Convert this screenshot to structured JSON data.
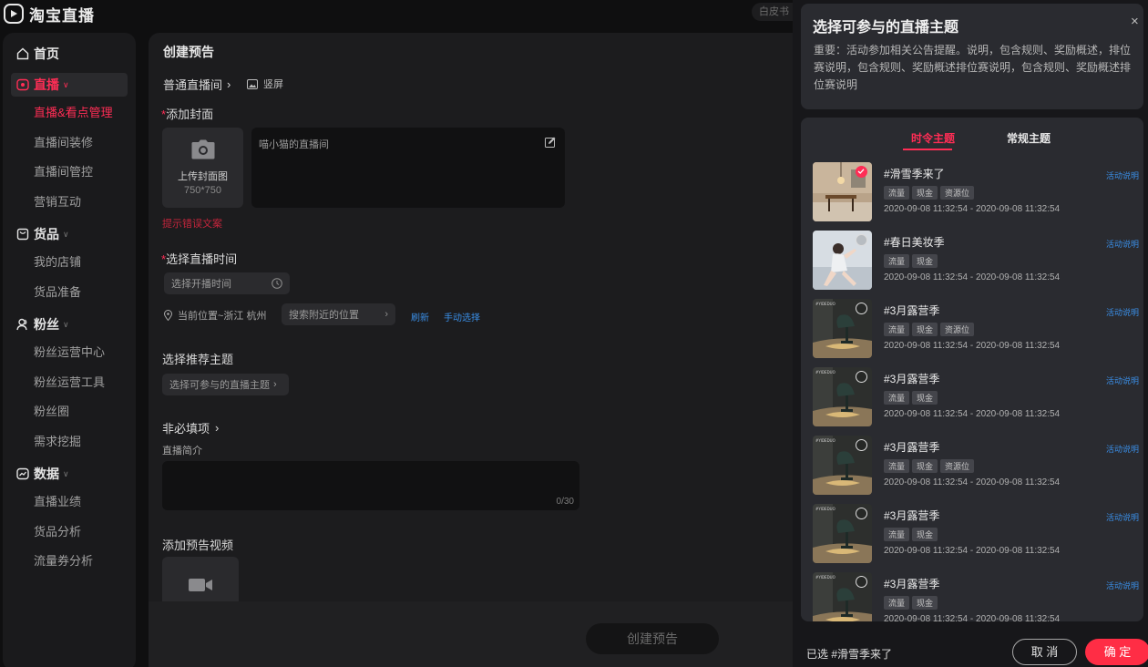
{
  "app": {
    "title": "淘宝直播",
    "skin_label": "白皮书"
  },
  "sidebar": {
    "groups": [
      {
        "label": "首页",
        "icon": "home-icon",
        "items": []
      },
      {
        "label": "直播",
        "icon": "live-icon",
        "items": [
          "直播&看点管理",
          "直播间装修",
          "直播间管控",
          "营销互动"
        ]
      },
      {
        "label": "货品",
        "icon": "goods-icon",
        "items": [
          "我的店铺",
          "货品准备"
        ]
      },
      {
        "label": "粉丝",
        "icon": "fans-icon",
        "items": [
          "粉丝运营中心",
          "粉丝运营工具",
          "粉丝圈",
          "需求挖掘"
        ]
      },
      {
        "label": "数据",
        "icon": "data-icon",
        "items": [
          "直播业绩",
          "货品分析",
          "流量券分析"
        ]
      }
    ],
    "active_group": "直播",
    "active_item": "直播&看点管理"
  },
  "main": {
    "title": "创建预告",
    "live_type": "普通直播间",
    "orientation": "竖屏",
    "cover": {
      "label": "添加封面",
      "upload_label": "上传封面图",
      "upload_size": "750*750",
      "title_placeholder": "喵小猫的直播间",
      "error_text": "提示错误文案"
    },
    "time": {
      "label": "选择直播时间",
      "placeholder": "选择开播时间",
      "location": "当前位置~浙江 杭州",
      "search_placeholder": "搜索附近的位置",
      "refresh": "刷新",
      "manual": "手动选择"
    },
    "theme": {
      "label": "选择推荐主题",
      "button": "选择可参与的直播主题"
    },
    "optional": {
      "label": "非必填项",
      "intro_label": "直播简介",
      "intro_counter": "0/30",
      "video_label": "添加预告视频"
    },
    "create_button": "创建预告"
  },
  "panel": {
    "title": "选择可参与的直播主题",
    "close": "×",
    "description": "重要：活动参加相关公告提醒。说明，包含规则、奖励概述，排位赛说明，包含规则、奖励概述排位赛说明，包含规则、奖励概述排位赛说明",
    "tabs": [
      "时令主题",
      "常规主题"
    ],
    "active_tab": "时令主题",
    "themes": [
      {
        "name": "#滑雪季来了",
        "tags": [
          "流量",
          "现金",
          "资源位"
        ],
        "time": "2020-09-08 11:32:54 - 2020-09-08 11:32:54",
        "link": "活动说明",
        "selected": true,
        "thumb": "room"
      },
      {
        "name": "#春日美妆季",
        "tags": [
          "流量",
          "现金"
        ],
        "time": "2020-09-08 11:32:54 - 2020-09-08 11:32:54",
        "link": "活动说明",
        "selected": false,
        "thumb": "person"
      },
      {
        "name": "#3月露营季",
        "tags": [
          "流量",
          "现金",
          "资源位"
        ],
        "time": "2020-09-08 11:32:54 - 2020-09-08 11:32:54",
        "link": "活动说明",
        "selected": false,
        "thumb": "lamp"
      },
      {
        "name": "#3月露营季",
        "tags": [
          "流量",
          "现金"
        ],
        "time": "2020-09-08 11:32:54 - 2020-09-08 11:32:54",
        "link": "活动说明",
        "selected": false,
        "thumb": "lamp"
      },
      {
        "name": "#3月露营季",
        "tags": [
          "流量",
          "现金",
          "资源位"
        ],
        "time": "2020-09-08 11:32:54 - 2020-09-08 11:32:54",
        "link": "活动说明",
        "selected": false,
        "thumb": "lamp"
      },
      {
        "name": "#3月露营季",
        "tags": [
          "流量",
          "现金"
        ],
        "time": "2020-09-08 11:32:54 - 2020-09-08 11:32:54",
        "link": "活动说明",
        "selected": false,
        "thumb": "lamp"
      },
      {
        "name": "#3月露营季",
        "tags": [
          "流量",
          "现金"
        ],
        "time": "2020-09-08 11:32:54 - 2020-09-08 11:32:54",
        "link": "活动说明",
        "selected": false,
        "thumb": "lamp"
      }
    ],
    "selected_text": "已选 #滑雪季来了",
    "cancel": "取 消",
    "confirm": "确 定"
  },
  "colors": {
    "accent": "#ff2d55",
    "link": "#3a8ee6",
    "panel_bg": "#2a2b30"
  }
}
